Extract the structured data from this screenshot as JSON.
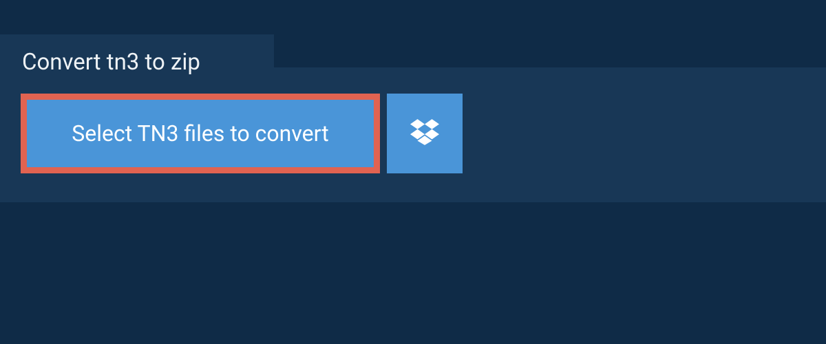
{
  "tab": {
    "title": "Convert tn3 to zip"
  },
  "actions": {
    "select_label": "Select TN3 files to convert"
  },
  "colors": {
    "page_bg": "#0f2b47",
    "panel_bg": "#183756",
    "button_bg": "#4a95d8",
    "button_border": "#e16351",
    "text_light": "#ffffff"
  }
}
